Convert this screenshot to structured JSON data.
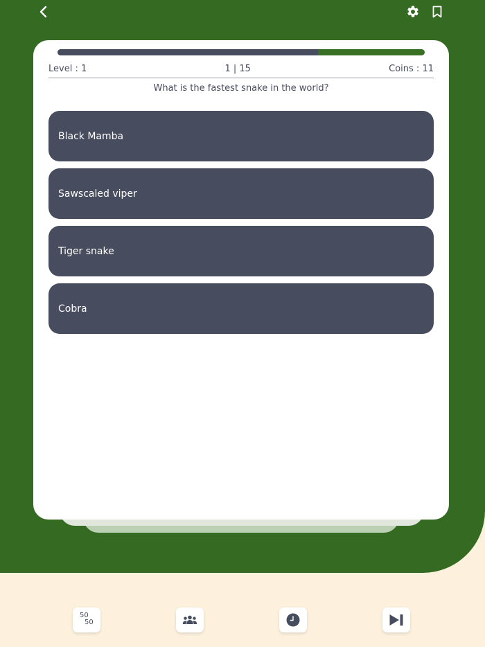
{
  "header": {
    "back_icon": "chevron-left-icon",
    "settings_icon": "gear-icon",
    "bookmark_icon": "bookmark-icon"
  },
  "quiz": {
    "progress_fraction": 0.71,
    "level": "Level : 1",
    "question_counter": "1 | 15",
    "coins": "Coins : 11",
    "question": "What is the fastest snake in the world?",
    "options": [
      {
        "label": "Black Mamba"
      },
      {
        "label": "Sawscaled viper"
      },
      {
        "label": "Tiger snake"
      },
      {
        "label": "Cobra"
      }
    ]
  },
  "lifelines": {
    "fifty_a": "50",
    "fifty_b": "50",
    "audience_icon": "audience-icon",
    "timer_icon": "clock-icon",
    "skip_icon": "skip-next-icon"
  },
  "colors": {
    "primary_green": "#346a22",
    "dark_slate": "#474c5e",
    "cream": "#fdf1de",
    "card": "#ffffff"
  }
}
